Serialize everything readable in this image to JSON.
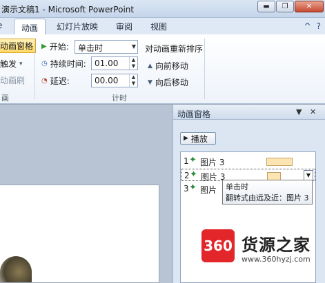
{
  "window": {
    "title": "演示文稿1 - Microsoft PowerPoint",
    "minimize": "▬",
    "restore": "❐",
    "close": "✕"
  },
  "tabs": [
    {
      "label": "动画"
    },
    {
      "label": "幻灯片放映"
    },
    {
      "label": "审阅"
    },
    {
      "label": "视图"
    }
  ],
  "tab_icons": {
    "help": "?",
    "collapse": "^"
  },
  "ribbon": {
    "advanced": {
      "animation_pane": "动画窗格",
      "trigger": "触发",
      "painter": "动画刷",
      "group_label": "画"
    },
    "timing": {
      "start_label": "开始:",
      "start_value": "单击时",
      "duration_label": "持续时间:",
      "duration_value": "01.00",
      "delay_label": "延迟:",
      "delay_value": "00.00",
      "reorder_title": "对动画重新排序",
      "move_earlier": "向前移动",
      "move_later": "向后移动",
      "group_label": "计时"
    }
  },
  "pane": {
    "title": "动画窗格",
    "play": "播放",
    "items": [
      {
        "num": "1",
        "label": "图片 3"
      },
      {
        "num": "2",
        "label": "图片 3"
      },
      {
        "num": "3",
        "label": "图片"
      }
    ],
    "tooltip_line1": "单击时",
    "tooltip_line2": "翻转式由远及近：图片 3"
  },
  "watermark": {
    "logo": "360",
    "name": "货源之家",
    "url": "www.360hyzj.com"
  },
  "colors": {
    "accent": "#2b6cb3",
    "highlight": "#ffd96a",
    "timeline_bar": "#fde4b3",
    "brand_red": "#e2262a"
  }
}
